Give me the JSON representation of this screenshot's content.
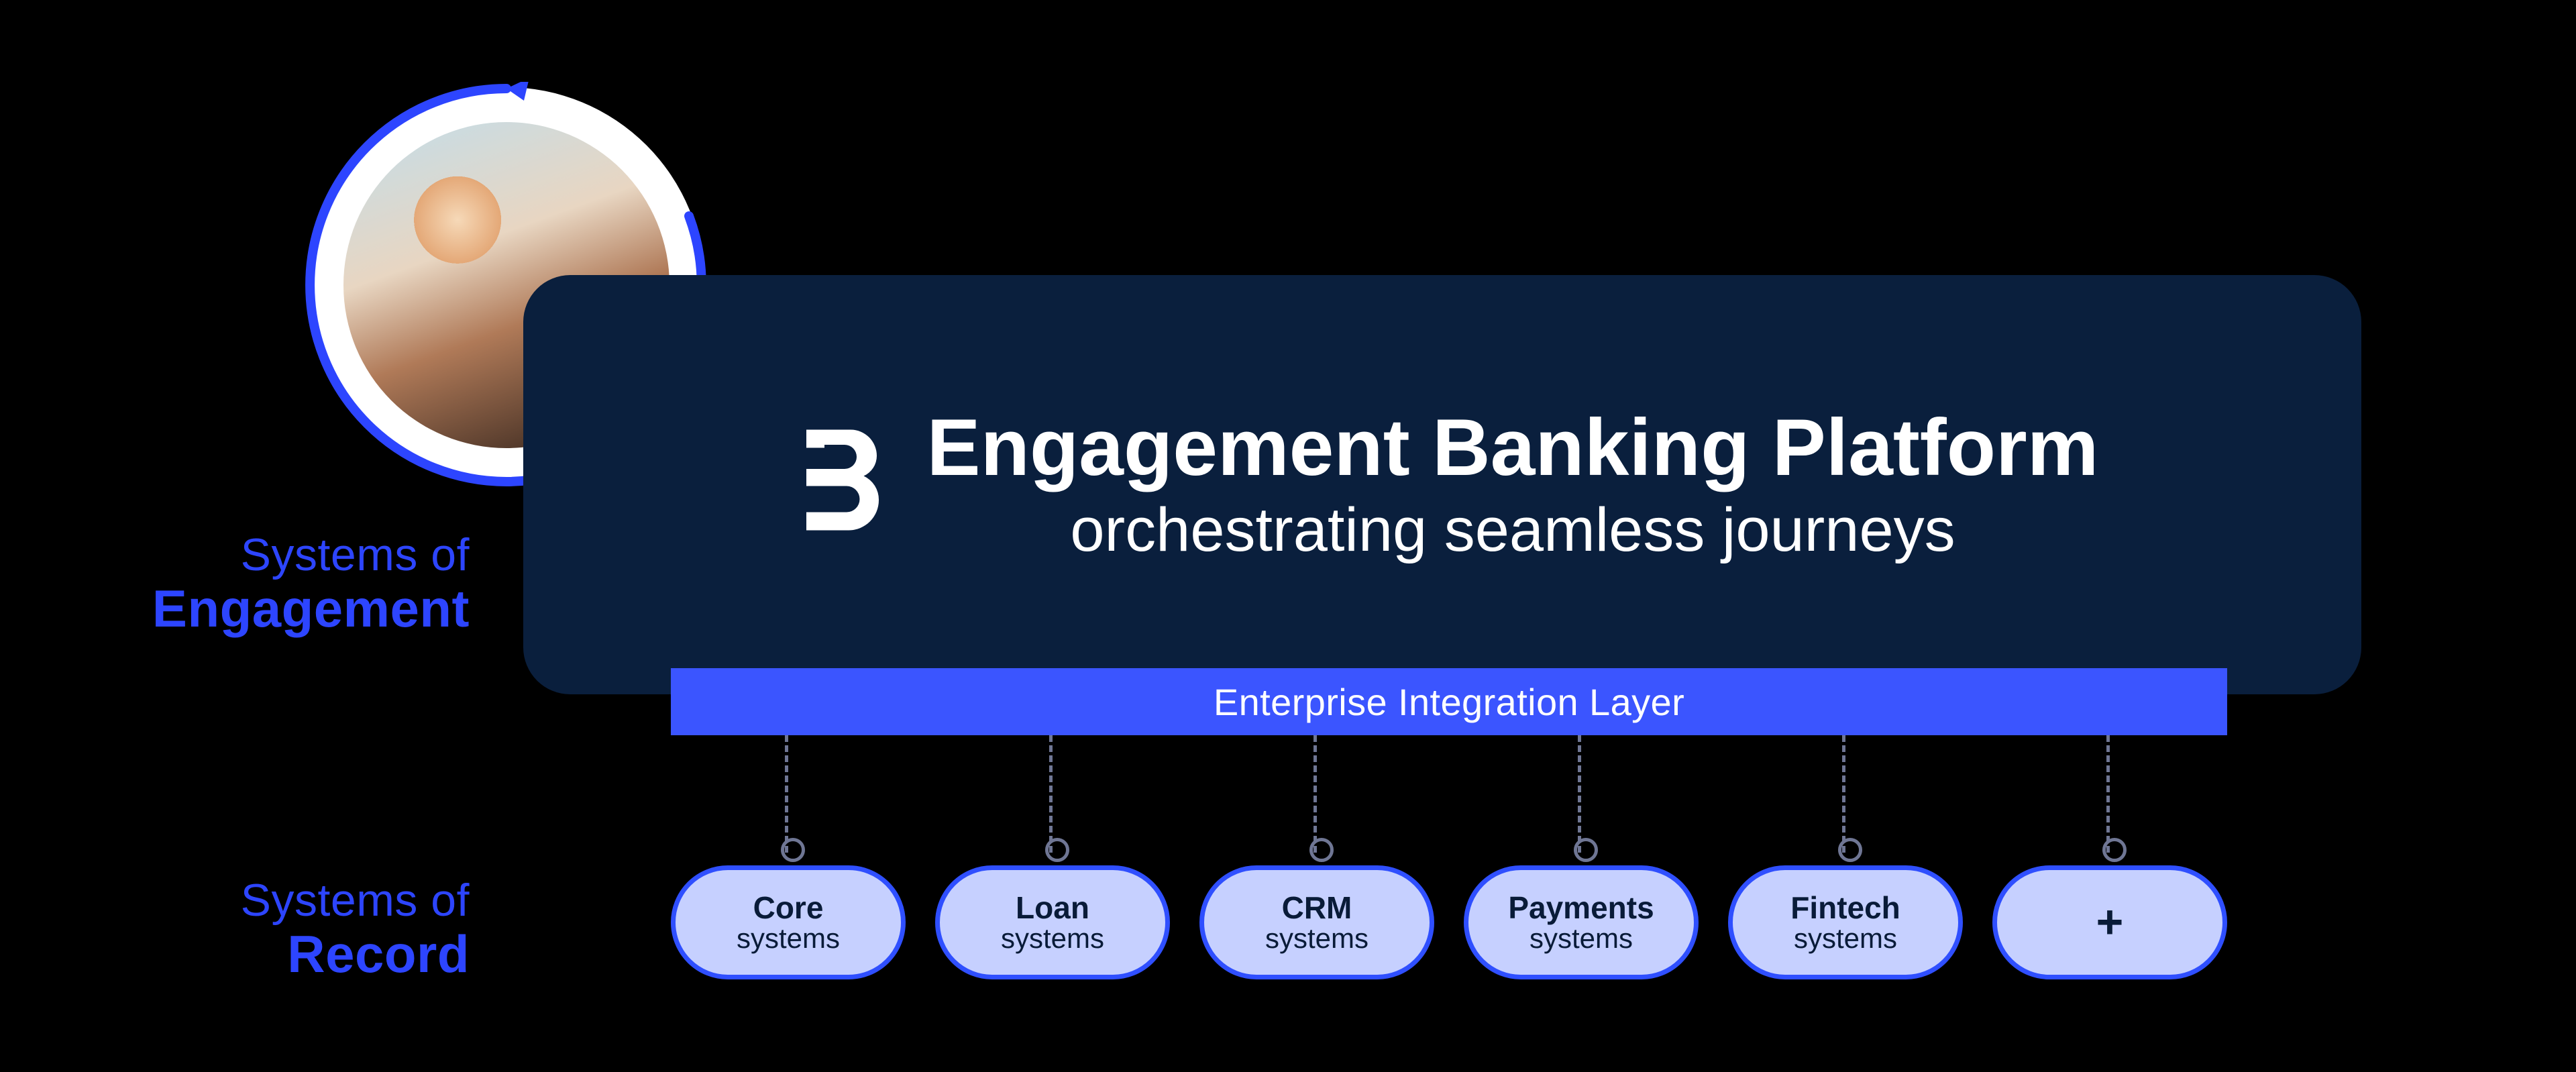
{
  "left_labels": {
    "engagement": {
      "line1": "Systems of",
      "line2": "Engagement"
    },
    "record": {
      "line1": "Systems of",
      "line2": "Record"
    }
  },
  "platform": {
    "title": "Engagement Banking Platform",
    "subtitle": "orchestrating seamless journeys"
  },
  "integration_layer": {
    "label": "Enterprise Integration Layer"
  },
  "record_systems": [
    {
      "top": "Core",
      "bottom": "systems"
    },
    {
      "top": "Loan",
      "bottom": "systems"
    },
    {
      "top": "CRM",
      "bottom": "systems"
    },
    {
      "top": "Payments",
      "bottom": "systems"
    },
    {
      "top": "Fintech",
      "bottom": "systems"
    },
    {
      "top": "+",
      "bottom": ""
    }
  ],
  "colors": {
    "background": "#000000",
    "navy": "#0a1f3d",
    "blue": "#2f4fff",
    "pill_fill": "#c6d0ff",
    "white": "#ffffff"
  }
}
